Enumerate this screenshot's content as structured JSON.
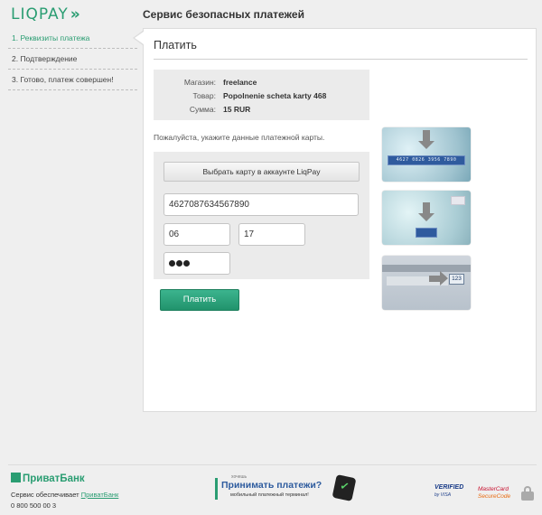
{
  "header": {
    "logo_text": "LIQPAY",
    "logo_chevrons": "»",
    "title": "Сервис безопасных платежей"
  },
  "steps": [
    {
      "label": "1. Реквизиты платежа",
      "active": true
    },
    {
      "label": "2. Подтверждение",
      "active": false
    },
    {
      "label": "3. Готово, платеж совершен!",
      "active": false
    }
  ],
  "payment": {
    "title": "Платить",
    "details": [
      {
        "label": "Магазин:",
        "value": "freelance"
      },
      {
        "label": "Товар:",
        "value": "Popolnenie scheta karty 468"
      },
      {
        "label": "Сумма:",
        "value": "15 RUR"
      }
    ],
    "hint": "Пожалуйста, укажите данные платежной карты.",
    "wallet_button": "Выбрать карту в аккаунте LiqPay",
    "card_number": "4627087634567890",
    "exp_month": "06",
    "exp_year": "17",
    "cvv_dots": 3,
    "pay_button": "Платить"
  },
  "card_images": {
    "card_number_sample": "4627 0826 3956 7890",
    "cvv_sample": "123"
  },
  "footer": {
    "bank_logo": "ПриватБанк",
    "service_text": "Сервис обеспечивает",
    "service_link": "ПриватБанк",
    "phone": "0 800 500 00 3",
    "promo_top": "хочешь",
    "promo_main": "Принимать платежи?",
    "promo_sub": "мобильный платежный терминал!",
    "visa_line1": "VERIFIED",
    "visa_line2": "by VISA",
    "mc_line1": "MasterCard",
    "mc_line2": "SecureCode"
  },
  "colors": {
    "brand_green": "#2a9d72",
    "link_blue": "#2d5b9e"
  }
}
